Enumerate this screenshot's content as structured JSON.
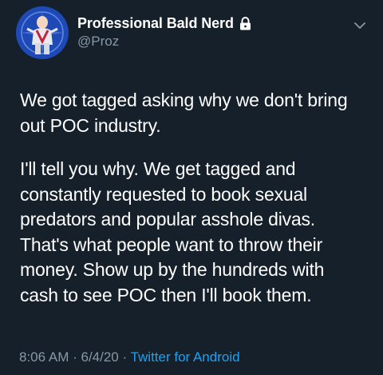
{
  "tweet": {
    "display_name": "Professional Bald Nerd",
    "handle": "@Proz",
    "paragraph_1": "We got tagged asking why we don't bring out POC industry.",
    "paragraph_2": "I'll tell you why. We get tagged and constantly requested to book sexual predators and popular asshole divas. That's what people want to throw their money. Show up by the hundreds with cash to see POC then I'll book them.",
    "time": "8:06 AM",
    "separator": " · ",
    "date": "6/4/20",
    "source": "Twitter for Android"
  },
  "icons": {
    "lock": "lock-icon",
    "menu": "chevron-down-icon",
    "avatar": "avatar"
  },
  "colors": {
    "background": "#15202b",
    "text": "#ffffff",
    "secondary": "#8899a6",
    "link": "#1da1f2"
  }
}
